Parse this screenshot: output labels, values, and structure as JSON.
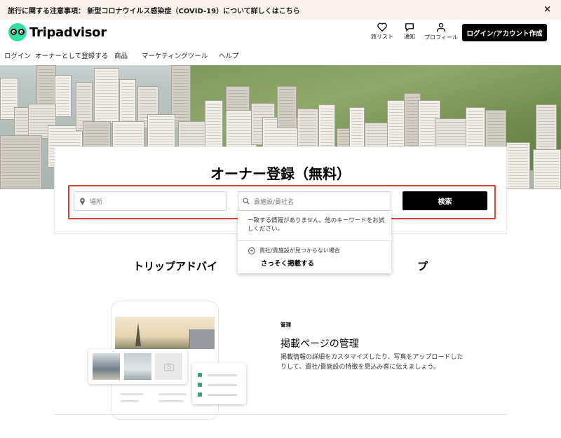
{
  "banner": {
    "text": "旅行に関する注意事項： 新型コロナウイルス感染症（COVID-19）について詳しくはこちら",
    "close": "×"
  },
  "header": {
    "logo_text": "Tripadvisor",
    "wishlist_label": "旅リスト",
    "notifications_label": "通知",
    "profile_label": "プロフィール",
    "login_button": "ログイン/アカウント作成"
  },
  "nav": {
    "items": [
      "ログイン",
      "オーナーとして登録する",
      "商品",
      "マーケティングツール",
      "ヘルプ"
    ]
  },
  "search": {
    "title": "オーナー登録（無料）",
    "location_placeholder": "場所",
    "business_placeholder": "貴施設/貴社名",
    "search_button": "検索",
    "icons": {
      "location": "map-pin-icon",
      "business": "search-icon"
    }
  },
  "dropdown": {
    "no_results": "一致する情報がありません。他のキーワードをお試しください。",
    "not_found_prompt": "貴社/貴施設が見つからない場合",
    "list_now": "さっそく掲載する"
  },
  "section": {
    "heading": "トリップアドバイ　　　　　　　　　　　　　　　　　　　プ"
  },
  "feature": {
    "tag": "管理",
    "title": "掲載ページの管理",
    "body": "掲載情報の詳細をカスタマイズしたり、写真をアップロードしたりして、貴社/貴施設の特徴を見込み客に伝えましょう。"
  },
  "colors": {
    "brand_green": "#34e0a1",
    "highlight_red": "#d9432d",
    "banner_bg": "#faf1ed",
    "button_black": "#000000"
  }
}
